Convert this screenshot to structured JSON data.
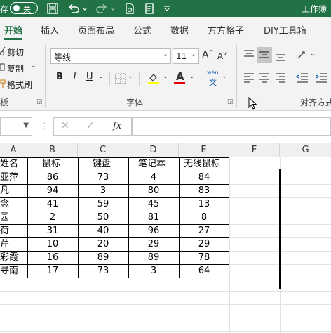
{
  "titlebar": {
    "autosave_label": "存",
    "toggle_state": "关",
    "title": "工作簿",
    "bg_color": "#217346"
  },
  "tabs": [
    {
      "label": "开始",
      "active": true
    },
    {
      "label": "插入"
    },
    {
      "label": "页面布局"
    },
    {
      "label": "公式"
    },
    {
      "label": "数据"
    },
    {
      "label": "方方格子"
    },
    {
      "label": "DIY工具箱"
    }
  ],
  "clipboard": {
    "cut": "剪切",
    "copy": "复制",
    "format_painter": "格式刷",
    "group_label": "板"
  },
  "font": {
    "name": "等线",
    "size": "11",
    "group_label": "字体",
    "bold": "B",
    "italic": "I",
    "underline": "U",
    "font_color_letter": "A",
    "phonetic_top": "wén",
    "phonetic_bottom": "文",
    "grow": "A",
    "shrink": "A"
  },
  "alignment": {
    "group_label": "对齐方式"
  },
  "formula_bar": {
    "name_box": "",
    "fx_label": "fx",
    "cancel": "✕",
    "enter": "✓",
    "formula": ""
  },
  "columns": [
    "A",
    "B",
    "C",
    "D",
    "E",
    "F",
    "G"
  ],
  "table": {
    "headers": [
      "姓名",
      "鼠标",
      "键盘",
      "笔记本",
      "无线鼠标"
    ],
    "rows": [
      [
        "亚萍",
        "86",
        "73",
        "4",
        "84"
      ],
      [
        "凡",
        "94",
        "3",
        "80",
        "83"
      ],
      [
        "念",
        "41",
        "59",
        "45",
        "13"
      ],
      [
        "园",
        "2",
        "50",
        "81",
        "8"
      ],
      [
        "荷",
        "31",
        "40",
        "96",
        "27"
      ],
      [
        "芹",
        "10",
        "20",
        "29",
        "29"
      ],
      [
        "彩霞",
        "16",
        "89",
        "89",
        "78"
      ],
      [
        "寻南",
        "17",
        "73",
        "3",
        "64"
      ]
    ]
  }
}
